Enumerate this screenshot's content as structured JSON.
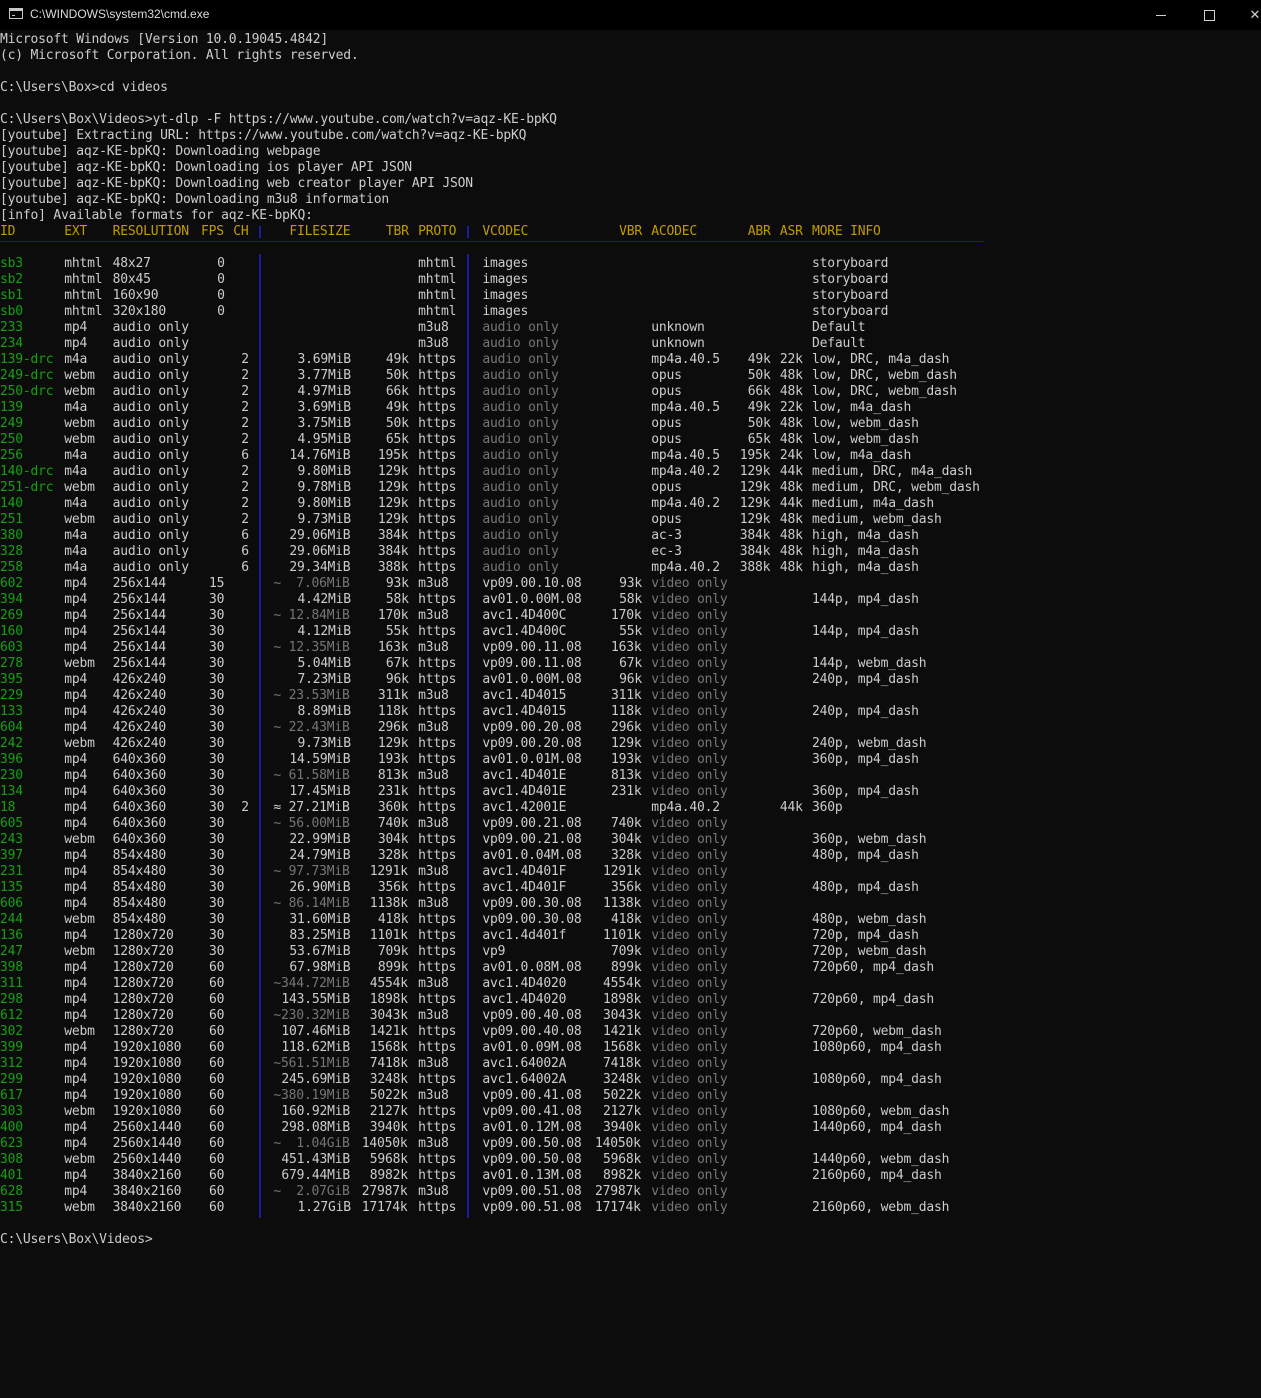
{
  "window": {
    "title": "C:\\WINDOWS\\system32\\cmd.exe"
  },
  "console": {
    "preamble": [
      "Microsoft Windows [Version 10.0.19045.4842]",
      "(c) Microsoft Corporation. All rights reserved.",
      "",
      "C:\\Users\\Box>cd videos",
      "",
      "C:\\Users\\Box\\Videos>yt-dlp -F https://www.youtube.com/watch?v=aqz-KE-bpKQ",
      "[youtube] Extracting URL: https://www.youtube.com/watch?v=aqz-KE-bpKQ",
      "[youtube] aqz-KE-bpKQ: Downloading webpage",
      "[youtube] aqz-KE-bpKQ: Downloading ios player API JSON",
      "[youtube] aqz-KE-bpKQ: Downloading web creator player API JSON",
      "[youtube] aqz-KE-bpKQ: Downloading m3u8 information",
      "[info] Available formats for aqz-KE-bpKQ:"
    ],
    "headers": {
      "id": "ID",
      "ext": "EXT",
      "res": "RESOLUTION",
      "fps": "FPS",
      "ch": "CH",
      "size": "FILESIZE",
      "tbr": "TBR",
      "proto": "PROTO",
      "vcodec": "VCODEC",
      "vbr": "VBR",
      "acodec": "ACODEC",
      "abr": "ABR",
      "asr": "ASR",
      "info": "MORE INFO"
    },
    "formats": [
      [
        "sb3",
        "mhtml",
        "48x27",
        "0",
        "",
        "",
        "",
        "mhtml",
        "images",
        "",
        "",
        "",
        "",
        "storyboard"
      ],
      [
        "sb2",
        "mhtml",
        "80x45",
        "0",
        "",
        "",
        "",
        "mhtml",
        "images",
        "",
        "",
        "",
        "",
        "storyboard"
      ],
      [
        "sb1",
        "mhtml",
        "160x90",
        "0",
        "",
        "",
        "",
        "mhtml",
        "images",
        "",
        "",
        "",
        "",
        "storyboard"
      ],
      [
        "sb0",
        "mhtml",
        "320x180",
        "0",
        "",
        "",
        "",
        "mhtml",
        "images",
        "",
        "",
        "",
        "",
        "storyboard"
      ],
      [
        "233",
        "mp4",
        "audio only",
        "",
        "",
        "",
        "",
        "m3u8",
        "audio only",
        "",
        "unknown",
        "",
        "",
        "Default"
      ],
      [
        "234",
        "mp4",
        "audio only",
        "",
        "",
        "",
        "",
        "m3u8",
        "audio only",
        "",
        "unknown",
        "",
        "",
        "Default"
      ],
      [
        "139-drc",
        "m4a",
        "audio only",
        "",
        "2",
        "3.69MiB",
        "49k",
        "https",
        "audio only",
        "",
        "mp4a.40.5",
        "49k",
        "22k",
        "low, DRC, m4a_dash"
      ],
      [
        "249-drc",
        "webm",
        "audio only",
        "",
        "2",
        "3.77MiB",
        "50k",
        "https",
        "audio only",
        "",
        "opus",
        "50k",
        "48k",
        "low, DRC, webm_dash"
      ],
      [
        "250-drc",
        "webm",
        "audio only",
        "",
        "2",
        "4.97MiB",
        "66k",
        "https",
        "audio only",
        "",
        "opus",
        "66k",
        "48k",
        "low, DRC, webm_dash"
      ],
      [
        "139",
        "m4a",
        "audio only",
        "",
        "2",
        "3.69MiB",
        "49k",
        "https",
        "audio only",
        "",
        "mp4a.40.5",
        "49k",
        "22k",
        "low, m4a_dash"
      ],
      [
        "249",
        "webm",
        "audio only",
        "",
        "2",
        "3.75MiB",
        "50k",
        "https",
        "audio only",
        "",
        "opus",
        "50k",
        "48k",
        "low, webm_dash"
      ],
      [
        "250",
        "webm",
        "audio only",
        "",
        "2",
        "4.95MiB",
        "65k",
        "https",
        "audio only",
        "",
        "opus",
        "65k",
        "48k",
        "low, webm_dash"
      ],
      [
        "256",
        "m4a",
        "audio only",
        "",
        "6",
        "14.76MiB",
        "195k",
        "https",
        "audio only",
        "",
        "mp4a.40.5",
        "195k",
        "24k",
        "low, m4a_dash"
      ],
      [
        "140-drc",
        "m4a",
        "audio only",
        "",
        "2",
        "9.80MiB",
        "129k",
        "https",
        "audio only",
        "",
        "mp4a.40.2",
        "129k",
        "44k",
        "medium, DRC, m4a_dash"
      ],
      [
        "251-drc",
        "webm",
        "audio only",
        "",
        "2",
        "9.78MiB",
        "129k",
        "https",
        "audio only",
        "",
        "opus",
        "129k",
        "48k",
        "medium, DRC, webm_dash"
      ],
      [
        "140",
        "m4a",
        "audio only",
        "",
        "2",
        "9.80MiB",
        "129k",
        "https",
        "audio only",
        "",
        "mp4a.40.2",
        "129k",
        "44k",
        "medium, m4a_dash"
      ],
      [
        "251",
        "webm",
        "audio only",
        "",
        "2",
        "9.73MiB",
        "129k",
        "https",
        "audio only",
        "",
        "opus",
        "129k",
        "48k",
        "medium, webm_dash"
      ],
      [
        "380",
        "m4a",
        "audio only",
        "",
        "6",
        "29.06MiB",
        "384k",
        "https",
        "audio only",
        "",
        "ac-3",
        "384k",
        "48k",
        "high, m4a_dash"
      ],
      [
        "328",
        "m4a",
        "audio only",
        "",
        "6",
        "29.06MiB",
        "384k",
        "https",
        "audio only",
        "",
        "ec-3",
        "384k",
        "48k",
        "high, m4a_dash"
      ],
      [
        "258",
        "m4a",
        "audio only",
        "",
        "6",
        "29.34MiB",
        "388k",
        "https",
        "audio only",
        "",
        "mp4a.40.2",
        "388k",
        "48k",
        "high, m4a_dash"
      ],
      [
        "602",
        "mp4",
        "256x144",
        "15",
        "",
        "~  7.06MiB",
        "93k",
        "m3u8",
        "vp09.00.10.08",
        "93k",
        "video only",
        "",
        "",
        ""
      ],
      [
        "394",
        "mp4",
        "256x144",
        "30",
        "",
        "4.42MiB",
        "58k",
        "https",
        "av01.0.00M.08",
        "58k",
        "video only",
        "",
        "",
        "144p, mp4_dash"
      ],
      [
        "269",
        "mp4",
        "256x144",
        "30",
        "",
        "~ 12.84MiB",
        "170k",
        "m3u8",
        "avc1.4D400C",
        "170k",
        "video only",
        "",
        "",
        ""
      ],
      [
        "160",
        "mp4",
        "256x144",
        "30",
        "",
        "4.12MiB",
        "55k",
        "https",
        "avc1.4D400C",
        "55k",
        "video only",
        "",
        "",
        "144p, mp4_dash"
      ],
      [
        "603",
        "mp4",
        "256x144",
        "30",
        "",
        "~ 12.35MiB",
        "163k",
        "m3u8",
        "vp09.00.11.08",
        "163k",
        "video only",
        "",
        "",
        ""
      ],
      [
        "278",
        "webm",
        "256x144",
        "30",
        "",
        "5.04MiB",
        "67k",
        "https",
        "vp09.00.11.08",
        "67k",
        "video only",
        "",
        "",
        "144p, webm_dash"
      ],
      [
        "395",
        "mp4",
        "426x240",
        "30",
        "",
        "7.23MiB",
        "96k",
        "https",
        "av01.0.00M.08",
        "96k",
        "video only",
        "",
        "",
        "240p, mp4_dash"
      ],
      [
        "229",
        "mp4",
        "426x240",
        "30",
        "",
        "~ 23.53MiB",
        "311k",
        "m3u8",
        "avc1.4D4015",
        "311k",
        "video only",
        "",
        "",
        ""
      ],
      [
        "133",
        "mp4",
        "426x240",
        "30",
        "",
        "8.89MiB",
        "118k",
        "https",
        "avc1.4D4015",
        "118k",
        "video only",
        "",
        "",
        "240p, mp4_dash"
      ],
      [
        "604",
        "mp4",
        "426x240",
        "30",
        "",
        "~ 22.43MiB",
        "296k",
        "m3u8",
        "vp09.00.20.08",
        "296k",
        "video only",
        "",
        "",
        ""
      ],
      [
        "242",
        "webm",
        "426x240",
        "30",
        "",
        "9.73MiB",
        "129k",
        "https",
        "vp09.00.20.08",
        "129k",
        "video only",
        "",
        "",
        "240p, webm_dash"
      ],
      [
        "396",
        "mp4",
        "640x360",
        "30",
        "",
        "14.59MiB",
        "193k",
        "https",
        "av01.0.01M.08",
        "193k",
        "video only",
        "",
        "",
        "360p, mp4_dash"
      ],
      [
        "230",
        "mp4",
        "640x360",
        "30",
        "",
        "~ 61.58MiB",
        "813k",
        "m3u8",
        "avc1.4D401E",
        "813k",
        "video only",
        "",
        "",
        ""
      ],
      [
        "134",
        "mp4",
        "640x360",
        "30",
        "",
        "17.45MiB",
        "231k",
        "https",
        "avc1.4D401E",
        "231k",
        "video only",
        "",
        "",
        "360p, mp4_dash"
      ],
      [
        "18",
        "mp4",
        "640x360",
        "30",
        "2",
        "≈ 27.21MiB",
        "360k",
        "https",
        "avc1.42001E",
        "",
        "mp4a.40.2",
        "",
        "44k",
        "360p"
      ],
      [
        "605",
        "mp4",
        "640x360",
        "30",
        "",
        "~ 56.00MiB",
        "740k",
        "m3u8",
        "vp09.00.21.08",
        "740k",
        "video only",
        "",
        "",
        ""
      ],
      [
        "243",
        "webm",
        "640x360",
        "30",
        "",
        "22.99MiB",
        "304k",
        "https",
        "vp09.00.21.08",
        "304k",
        "video only",
        "",
        "",
        "360p, webm_dash"
      ],
      [
        "397",
        "mp4",
        "854x480",
        "30",
        "",
        "24.79MiB",
        "328k",
        "https",
        "av01.0.04M.08",
        "328k",
        "video only",
        "",
        "",
        "480p, mp4_dash"
      ],
      [
        "231",
        "mp4",
        "854x480",
        "30",
        "",
        "~ 97.73MiB",
        "1291k",
        "m3u8",
        "avc1.4D401F",
        "1291k",
        "video only",
        "",
        "",
        ""
      ],
      [
        "135",
        "mp4",
        "854x480",
        "30",
        "",
        "26.90MiB",
        "356k",
        "https",
        "avc1.4D401F",
        "356k",
        "video only",
        "",
        "",
        "480p, mp4_dash"
      ],
      [
        "606",
        "mp4",
        "854x480",
        "30",
        "",
        "~ 86.14MiB",
        "1138k",
        "m3u8",
        "vp09.00.30.08",
        "1138k",
        "video only",
        "",
        "",
        ""
      ],
      [
        "244",
        "webm",
        "854x480",
        "30",
        "",
        "31.60MiB",
        "418k",
        "https",
        "vp09.00.30.08",
        "418k",
        "video only",
        "",
        "",
        "480p, webm_dash"
      ],
      [
        "136",
        "mp4",
        "1280x720",
        "30",
        "",
        "83.25MiB",
        "1101k",
        "https",
        "avc1.4d401f",
        "1101k",
        "video only",
        "",
        "",
        "720p, mp4_dash"
      ],
      [
        "247",
        "webm",
        "1280x720",
        "30",
        "",
        "53.67MiB",
        "709k",
        "https",
        "vp9",
        "709k",
        "video only",
        "",
        "",
        "720p, webm_dash"
      ],
      [
        "398",
        "mp4",
        "1280x720",
        "60",
        "",
        "67.98MiB",
        "899k",
        "https",
        "av01.0.08M.08",
        "899k",
        "video only",
        "",
        "",
        "720p60, mp4_dash"
      ],
      [
        "311",
        "mp4",
        "1280x720",
        "60",
        "",
        "~344.72MiB",
        "4554k",
        "m3u8",
        "avc1.4D4020",
        "4554k",
        "video only",
        "",
        "",
        ""
      ],
      [
        "298",
        "mp4",
        "1280x720",
        "60",
        "",
        "143.55MiB",
        "1898k",
        "https",
        "avc1.4D4020",
        "1898k",
        "video only",
        "",
        "",
        "720p60, mp4_dash"
      ],
      [
        "612",
        "mp4",
        "1280x720",
        "60",
        "",
        "~230.32MiB",
        "3043k",
        "m3u8",
        "vp09.00.40.08",
        "3043k",
        "video only",
        "",
        "",
        ""
      ],
      [
        "302",
        "webm",
        "1280x720",
        "60",
        "",
        "107.46MiB",
        "1421k",
        "https",
        "vp09.00.40.08",
        "1421k",
        "video only",
        "",
        "",
        "720p60, webm_dash"
      ],
      [
        "399",
        "mp4",
        "1920x1080",
        "60",
        "",
        "118.62MiB",
        "1568k",
        "https",
        "av01.0.09M.08",
        "1568k",
        "video only",
        "",
        "",
        "1080p60, mp4_dash"
      ],
      [
        "312",
        "mp4",
        "1920x1080",
        "60",
        "",
        "~561.51MiB",
        "7418k",
        "m3u8",
        "avc1.64002A",
        "7418k",
        "video only",
        "",
        "",
        ""
      ],
      [
        "299",
        "mp4",
        "1920x1080",
        "60",
        "",
        "245.69MiB",
        "3248k",
        "https",
        "avc1.64002A",
        "3248k",
        "video only",
        "",
        "",
        "1080p60, mp4_dash"
      ],
      [
        "617",
        "mp4",
        "1920x1080",
        "60",
        "",
        "~380.19MiB",
        "5022k",
        "m3u8",
        "vp09.00.41.08",
        "5022k",
        "video only",
        "",
        "",
        ""
      ],
      [
        "303",
        "webm",
        "1920x1080",
        "60",
        "",
        "160.92MiB",
        "2127k",
        "https",
        "vp09.00.41.08",
        "2127k",
        "video only",
        "",
        "",
        "1080p60, webm_dash"
      ],
      [
        "400",
        "mp4",
        "2560x1440",
        "60",
        "",
        "298.08MiB",
        "3940k",
        "https",
        "av01.0.12M.08",
        "3940k",
        "video only",
        "",
        "",
        "1440p60, mp4_dash"
      ],
      [
        "623",
        "mp4",
        "2560x1440",
        "60",
        "",
        "~  1.04GiB",
        "14050k",
        "m3u8",
        "vp09.00.50.08",
        "14050k",
        "video only",
        "",
        "",
        ""
      ],
      [
        "308",
        "webm",
        "2560x1440",
        "60",
        "",
        "451.43MiB",
        "5968k",
        "https",
        "vp09.00.50.08",
        "5968k",
        "video only",
        "",
        "",
        "1440p60, webm_dash"
      ],
      [
        "401",
        "mp4",
        "3840x2160",
        "60",
        "",
        "679.44MiB",
        "8982k",
        "https",
        "av01.0.13M.08",
        "8982k",
        "video only",
        "",
        "",
        "2160p60, mp4_dash"
      ],
      [
        "628",
        "mp4",
        "3840x2160",
        "60",
        "",
        "~  2.07GiB",
        "27987k",
        "m3u8",
        "vp09.00.51.08",
        "27987k",
        "video only",
        "",
        "",
        ""
      ],
      [
        "315",
        "webm",
        "3840x2160",
        "60",
        "",
        "1.27GiB",
        "17174k",
        "https",
        "vp09.00.51.08",
        "17174k",
        "video only",
        "",
        "",
        "2160p60, webm_dash"
      ]
    ],
    "prompt": "C:\\Users\\Box\\Videos>"
  }
}
